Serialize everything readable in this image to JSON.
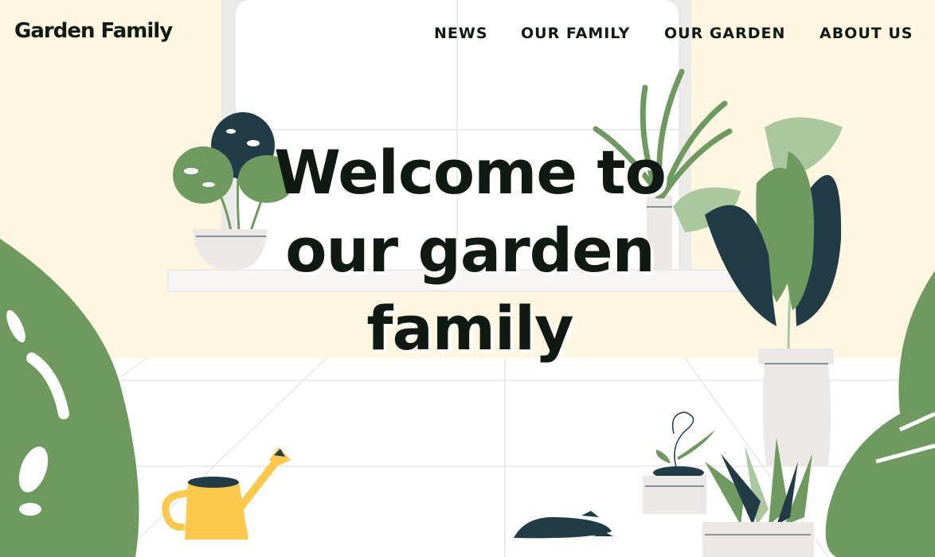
{
  "brand": {
    "logo_text": "Garden Family"
  },
  "nav": {
    "items": [
      {
        "label": "NEWS"
      },
      {
        "label": "OUR FAMILY"
      },
      {
        "label": "OUR GARDEN"
      },
      {
        "label": "ABOUT US"
      }
    ]
  },
  "hero": {
    "line1": "Welcome to",
    "line2": "our garden",
    "line3": "family"
  },
  "colors": {
    "wall": "#fdf6e1",
    "floor": "#ffffff",
    "dark_green": "#213b47",
    "mid_green": "#6e9a5f",
    "light_green": "#aac79d",
    "pot": "#ebe8e5",
    "watering_can": "#fdc94c",
    "text": "#111a12"
  }
}
